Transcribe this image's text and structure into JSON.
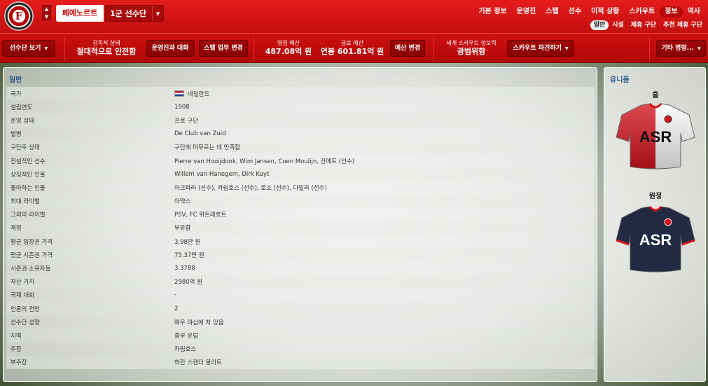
{
  "crest": {
    "letter": "F"
  },
  "header": {
    "club_name": "페예노르트",
    "squad_select": "1군 선수단",
    "nav": [
      "기본 정보",
      "운영진",
      "스탭",
      "선수",
      "이적 상황",
      "스카우트",
      "정보",
      "역사"
    ],
    "subnav": [
      "일반",
      "시설",
      "제휴 구단",
      "추천 제휴 구단"
    ]
  },
  "toolbar": {
    "squad_view": "선수단 보기",
    "manager_status_label": "감독직 상태",
    "manager_status_value": "절대적으로 안전함",
    "board_talk": "운영진과 대화",
    "staff_change": "스탭 업무 변경",
    "transfer_budget_label": "영입 예산",
    "transfer_budget_value": "487.08억 원",
    "wage_budget_label": "급료 예산",
    "wage_budget_value": "연봉 601.81억 원",
    "budget_change": "예산 변경",
    "scout_label": "세계 스카우트 정보력",
    "scout_value": "광범위함",
    "scout_dispatch": "스카우트 파견하기",
    "other_orders": "기타 명령..."
  },
  "general": {
    "title": "일반",
    "rows": [
      {
        "key": "국가",
        "value": "네덜란드"
      },
      {
        "key": "설립연도",
        "value": "1908"
      },
      {
        "key": "운영 상태",
        "value": "프로 구단"
      },
      {
        "key": "별명",
        "value": "De Club van Zuid"
      },
      {
        "key": "구단주 상태",
        "value": "구단에 머무르는 데 만족함"
      },
      {
        "key": "전설적인 선수",
        "value": "Pierre van Hooijdonk, Wim Jansen, Coen Moulijn, 잔메트 (선수)"
      },
      {
        "key": "상징적인 인물",
        "value": "Willem van Hanegem, Dirk Kuyt"
      },
      {
        "key": "좋아하는 인물",
        "value": "아크파라 (선수), 카림호스 (선수), 로소 (선수), 다빌라 (선수)"
      },
      {
        "key": "최대 라이벌",
        "value": "아약스"
      },
      {
        "key": "그외의 라이벌",
        "value": "PSV, FC 위트레흐트"
      },
      {
        "key": "재정",
        "value": "부유함"
      },
      {
        "key": "평균 입장권 가격",
        "value": "3.98만 원"
      },
      {
        "key": "평균 시즌권 가격",
        "value": "75.37만 원"
      },
      {
        "key": "시즌권 소유자들",
        "value": "3.3788"
      },
      {
        "key": "자산 가치",
        "value": "2980억 원"
      },
      {
        "key": "국제 대회",
        "value": "-"
      },
      {
        "key": "언론의 전망",
        "value": "2"
      },
      {
        "key": "선수단 성향",
        "value": "매우 야심에 차 있음"
      },
      {
        "key": "지역",
        "value": "중부 유럽"
      },
      {
        "key": "주장",
        "value": "카림호스"
      },
      {
        "key": "부주장",
        "value": "하칸 스켄더 볼라트"
      }
    ]
  },
  "uniform": {
    "title": "유니폼",
    "home_label": "홈",
    "away_label": "원정",
    "sponsor": "ASR",
    "colors": {
      "home_red": "#d8121c",
      "home_white": "#ffffff",
      "away_navy": "#222a44",
      "trim": "#d8121c"
    }
  }
}
